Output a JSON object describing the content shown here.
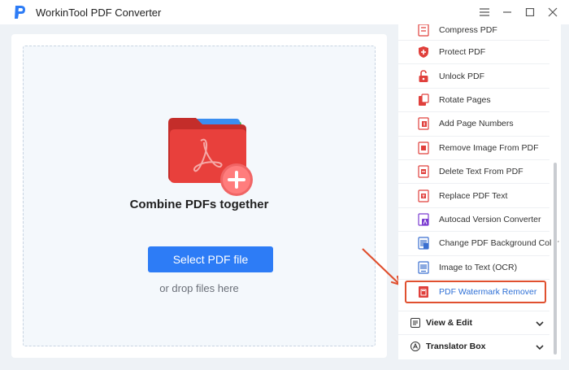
{
  "app": {
    "title": "WorkinTool PDF Converter"
  },
  "window_controls": [
    "settings",
    "minimize",
    "maximize",
    "close"
  ],
  "main": {
    "headline": "Combine PDFs together",
    "select_button": "Select PDF file",
    "drop_hint": "or drop files here"
  },
  "sidebar": {
    "tools": [
      {
        "label": "Compress PDF",
        "icon": "compress-icon"
      },
      {
        "label": "Protect PDF",
        "icon": "shield-icon"
      },
      {
        "label": "Unlock PDF",
        "icon": "unlock-icon"
      },
      {
        "label": "Rotate Pages",
        "icon": "rotate-icon"
      },
      {
        "label": "Add Page Numbers",
        "icon": "page-number-icon"
      },
      {
        "label": "Remove Image From PDF",
        "icon": "remove-image-icon"
      },
      {
        "label": "Delete Text From PDF",
        "icon": "delete-text-icon"
      },
      {
        "label": "Replace PDF Text",
        "icon": "replace-text-icon"
      },
      {
        "label": "Autocad Version Converter",
        "icon": "autocad-icon"
      },
      {
        "label": "Change PDF Background Color",
        "icon": "background-color-icon"
      },
      {
        "label": "Image to Text (OCR)",
        "icon": "ocr-icon"
      },
      {
        "label": "PDF Watermark Remover",
        "icon": "watermark-icon",
        "highlighted": true
      }
    ],
    "sections": [
      {
        "label": "View & Edit",
        "icon": "view-edit-icon"
      },
      {
        "label": "Translator Box",
        "icon": "translator-icon"
      }
    ]
  },
  "colors": {
    "accent": "#2d7cf6",
    "highlight_border": "#e0502f",
    "folder_red": "#e8403c",
    "background": "#eef2f6"
  }
}
